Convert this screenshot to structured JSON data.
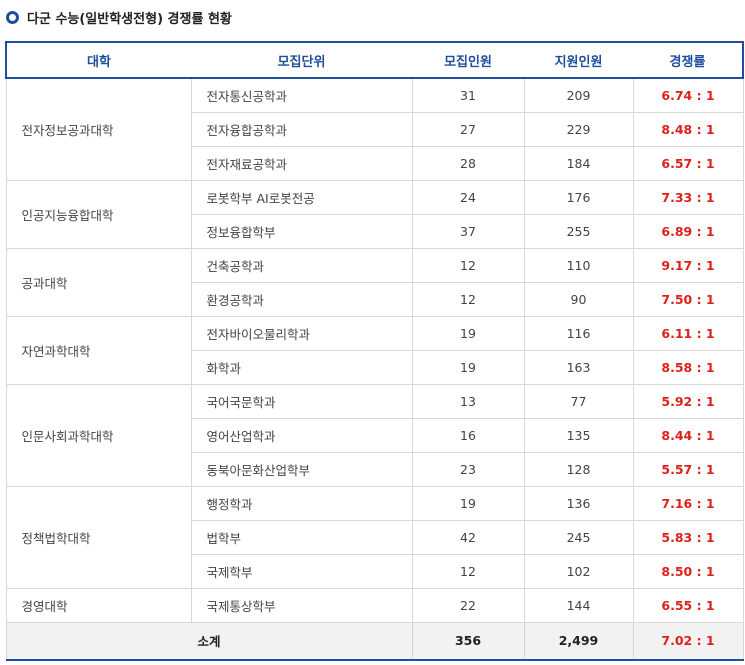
{
  "title": "다군 수능(일반학생전형) 경쟁률 현황",
  "headers": [
    "대학",
    "모집단위",
    "모집인원",
    "지원인원",
    "경쟁률"
  ],
  "colleges": [
    {
      "name": "전자정보공과대학",
      "rows": [
        {
          "dept": "전자통신공학과",
          "quota": "31",
          "applicants": "209",
          "ratio": "6.74 : 1"
        },
        {
          "dept": "전자융합공학과",
          "quota": "27",
          "applicants": "229",
          "ratio": "8.48 : 1"
        },
        {
          "dept": "전자재료공학과",
          "quota": "28",
          "applicants": "184",
          "ratio": "6.57 : 1"
        }
      ]
    },
    {
      "name": "인공지능융합대학",
      "rows": [
        {
          "dept": "로봇학부 AI로봇전공",
          "quota": "24",
          "applicants": "176",
          "ratio": "7.33 : 1"
        },
        {
          "dept": "정보융합학부",
          "quota": "37",
          "applicants": "255",
          "ratio": "6.89 : 1"
        }
      ]
    },
    {
      "name": "공과대학",
      "rows": [
        {
          "dept": "건축공학과",
          "quota": "12",
          "applicants": "110",
          "ratio": "9.17 : 1"
        },
        {
          "dept": "환경공학과",
          "quota": "12",
          "applicants": "90",
          "ratio": "7.50 : 1"
        }
      ]
    },
    {
      "name": "자연과학대학",
      "rows": [
        {
          "dept": "전자바이오물리학과",
          "quota": "19",
          "applicants": "116",
          "ratio": "6.11 : 1"
        },
        {
          "dept": "화학과",
          "quota": "19",
          "applicants": "163",
          "ratio": "8.58 : 1"
        }
      ]
    },
    {
      "name": "인문사회과학대학",
      "rows": [
        {
          "dept": "국어국문학과",
          "quota": "13",
          "applicants": "77",
          "ratio": "5.92 : 1"
        },
        {
          "dept": "영어산업학과",
          "quota": "16",
          "applicants": "135",
          "ratio": "8.44 : 1"
        },
        {
          "dept": "동북아문화산업학부",
          "quota": "23",
          "applicants": "128",
          "ratio": "5.57 : 1"
        }
      ]
    },
    {
      "name": "정책법학대학",
      "rows": [
        {
          "dept": "행정학과",
          "quota": "19",
          "applicants": "136",
          "ratio": "7.16 : 1"
        },
        {
          "dept": "법학부",
          "quota": "42",
          "applicants": "245",
          "ratio": "5.83 : 1"
        },
        {
          "dept": "국제학부",
          "quota": "12",
          "applicants": "102",
          "ratio": "8.50 : 1"
        }
      ]
    },
    {
      "name": "경영대학",
      "rows": [
        {
          "dept": "국제통상학부",
          "quota": "22",
          "applicants": "144",
          "ratio": "6.55 : 1"
        }
      ]
    }
  ],
  "total": {
    "label": "소계",
    "quota": "356",
    "applicants": "2,499",
    "ratio": "7.02 : 1"
  },
  "colors": {
    "accent": "#1e4e9c",
    "ratio": "#e0201a",
    "total_bg": "#f2f2f2"
  }
}
